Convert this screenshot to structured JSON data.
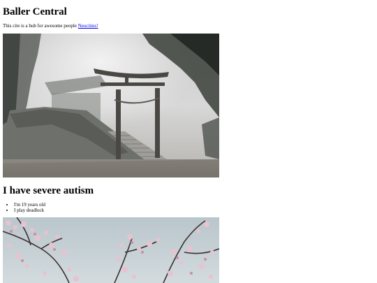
{
  "header": {
    "title": "Baller Central"
  },
  "intro": {
    "text": "This cite is a hub for awesome people ",
    "link_label": "Neocities!"
  },
  "section": {
    "heading": "I have severe autism",
    "items": [
      "I'm 19 years old",
      "I play deadlock"
    ]
  },
  "colors": {
    "link": "#0000ee",
    "text": "#000000",
    "background": "#ffffff"
  }
}
